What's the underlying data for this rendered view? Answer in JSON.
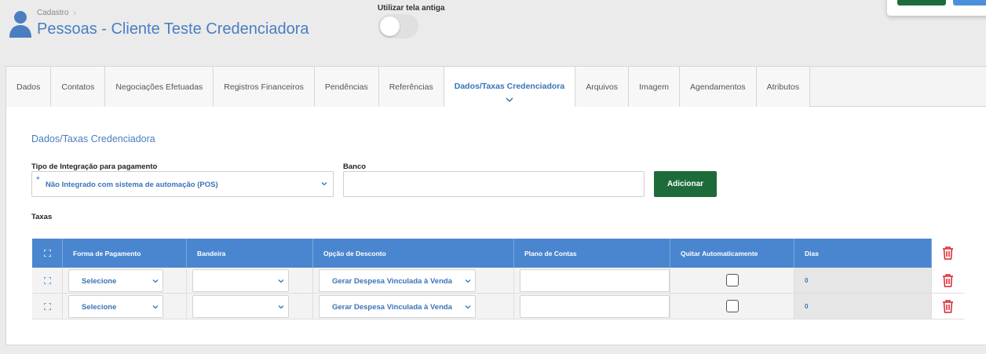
{
  "header": {
    "breadcrumb": "Cadastro",
    "title": "Pessoas - Cliente Teste Credenciadora",
    "old_screen_label": "Utilizar tela antiga",
    "old_screen_enabled": false
  },
  "tabs": [
    {
      "label": "Dados",
      "active": false
    },
    {
      "label": "Contatos",
      "active": false
    },
    {
      "label": "Negociações Efetuadas",
      "active": false
    },
    {
      "label": "Registros Financeiros",
      "active": false
    },
    {
      "label": "Pendências",
      "active": false
    },
    {
      "label": "Referências",
      "active": false
    },
    {
      "label": "Dados/Taxas Credenciadora",
      "active": true
    },
    {
      "label": "Arquivos",
      "active": false
    },
    {
      "label": "Imagem",
      "active": false
    },
    {
      "label": "Agendamentos",
      "active": false
    },
    {
      "label": "Atributos",
      "active": false
    }
  ],
  "section": {
    "title": "Dados/Taxas Credenciadora",
    "integration_label": "Tipo de Integração para pagamento",
    "integration_required_mark": "*",
    "integration_value": "Não Integrado com sistema de automação (POS)",
    "bank_label": "Banco",
    "bank_value": "",
    "add_label": "Adicionar",
    "taxes_label": "Taxas"
  },
  "table": {
    "headers": [
      "Forma de Pagamento",
      "Bandeira",
      "Opção de Desconto",
      "Plano de Contas",
      "Quitar Automaticamente",
      "Dias"
    ],
    "rows": [
      {
        "payment": "Selecione",
        "brand": "",
        "discount": "Gerar Despesa Vinculada à Venda",
        "account_plan": "",
        "auto_settle": false,
        "days": "0"
      },
      {
        "payment": "Selecione",
        "brand": "",
        "discount": "Gerar Despesa Vinculada à Venda",
        "account_plan": "",
        "auto_settle": false,
        "days": "0"
      }
    ]
  },
  "colors": {
    "accent_blue": "#4a7ec1",
    "header_blue": "#4a86cf",
    "primary_green": "#1e6b3a",
    "delete_red": "#d9232d"
  },
  "icons": {
    "avatar": "user-icon",
    "expand": "expand-icon",
    "delete": "trash-icon",
    "caret": "chevron-down-icon"
  }
}
